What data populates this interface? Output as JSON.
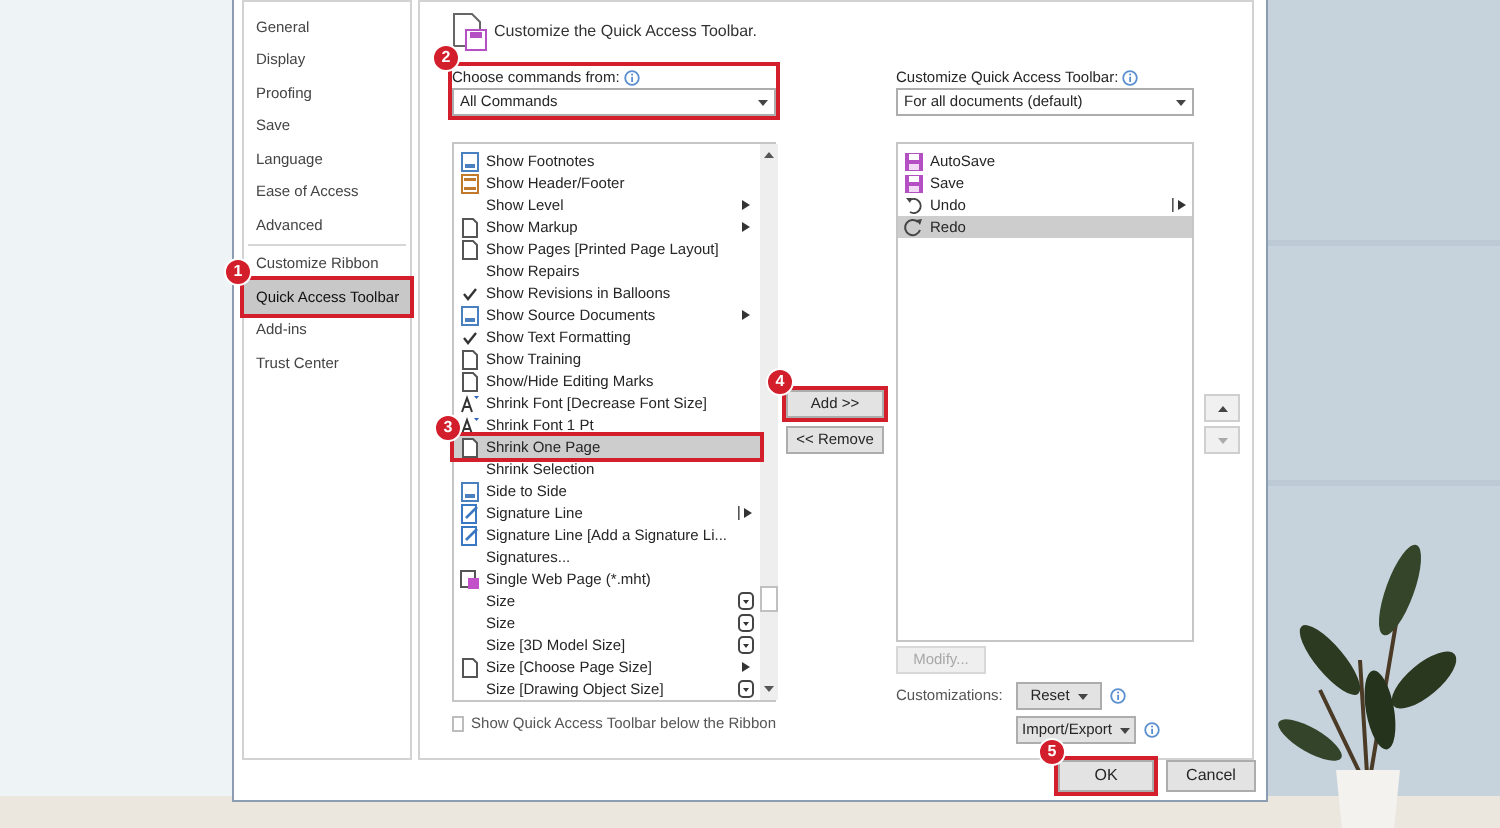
{
  "nav": {
    "groups": [
      {
        "items": [
          {
            "label": "General",
            "selected": false
          },
          {
            "label": "Display",
            "selected": false
          },
          {
            "label": "Proofing",
            "selected": false
          },
          {
            "label": "Save",
            "selected": false
          },
          {
            "label": "Language",
            "selected": false
          },
          {
            "label": "Ease of Access",
            "selected": false
          },
          {
            "label": "Advanced",
            "selected": false
          }
        ]
      },
      {
        "items": [
          {
            "label": "Customize Ribbon",
            "selected": false
          },
          {
            "label": "Quick Access Toolbar",
            "selected": true,
            "step": "1"
          },
          {
            "label": "Add-ins",
            "selected": false
          },
          {
            "label": "Trust Center",
            "selected": false
          }
        ]
      }
    ]
  },
  "main": {
    "title": "Customize the Quick Access Toolbar.",
    "commands_from": {
      "label": "Choose commands from:",
      "value": "All Commands",
      "step": "2"
    },
    "commands": [
      {
        "label": "Show Footnotes",
        "kind": "plain",
        "selected": false
      },
      {
        "label": "Show Header/Footer",
        "kind": "plain",
        "selected": false
      },
      {
        "label": "Show Level",
        "kind": "submenu",
        "selected": false
      },
      {
        "label": "Show Markup",
        "kind": "submenu",
        "selected": false
      },
      {
        "label": "Show Pages [Printed Page Layout]",
        "kind": "plain",
        "selected": false
      },
      {
        "label": "Show Repairs",
        "kind": "plain",
        "selected": false
      },
      {
        "label": "Show Revisions in Balloons",
        "kind": "plain",
        "selected": false
      },
      {
        "label": "Show Source Documents",
        "kind": "submenu",
        "selected": false
      },
      {
        "label": "Show Text Formatting",
        "kind": "plain",
        "selected": false
      },
      {
        "label": "Show Training",
        "kind": "plain",
        "selected": false
      },
      {
        "label": "Show/Hide Editing Marks",
        "kind": "plain",
        "selected": false
      },
      {
        "label": "Shrink Font [Decrease Font Size]",
        "kind": "plain",
        "selected": false
      },
      {
        "label": "Shrink Font 1 Pt",
        "kind": "plain",
        "selected": false
      },
      {
        "label": "Shrink One Page",
        "kind": "plain",
        "selected": true,
        "step": "3"
      },
      {
        "label": "Shrink Selection",
        "kind": "plain",
        "selected": false
      },
      {
        "label": "Side to Side",
        "kind": "plain",
        "selected": false
      },
      {
        "label": "Signature Line",
        "kind": "split",
        "selected": false
      },
      {
        "label": "Signature Line [Add a Signature Li...",
        "kind": "plain",
        "selected": false
      },
      {
        "label": "Signatures...",
        "kind": "plain",
        "selected": false
      },
      {
        "label": "Single Web Page (*.mht)",
        "kind": "plain",
        "selected": false
      },
      {
        "label": "Size",
        "kind": "field",
        "selected": false
      },
      {
        "label": "Size",
        "kind": "field",
        "selected": false
      },
      {
        "label": "Size [3D Model Size]",
        "kind": "field",
        "selected": false
      },
      {
        "label": "Size [Choose Page Size]",
        "kind": "submenu",
        "selected": false
      },
      {
        "label": "Size [Drawing Object Size]",
        "kind": "field",
        "selected": false
      }
    ],
    "show_below_ribbon": {
      "label": "Show Quick Access Toolbar below the Ribbon",
      "checked": false
    },
    "add_button": {
      "label": "Add >>",
      "step": "4"
    },
    "remove_button": {
      "label": "<< Remove"
    },
    "toolbar_for": {
      "label": "Customize Quick Access Toolbar:",
      "value": "For all documents (default)"
    },
    "toolbar_items": [
      {
        "label": "AutoSave",
        "kind": "plain",
        "selected": false
      },
      {
        "label": "Save",
        "kind": "plain",
        "selected": false
      },
      {
        "label": "Undo",
        "kind": "split",
        "selected": false
      },
      {
        "label": "Redo",
        "kind": "plain",
        "selected": true
      }
    ],
    "modify_button": {
      "label": "Modify...",
      "disabled": true
    },
    "customizations_label": "Customizations:",
    "reset_button": {
      "label": "Reset"
    },
    "import_export_button": {
      "label": "Import/Export"
    }
  },
  "footer": {
    "ok": {
      "label": "OK",
      "step": "5"
    },
    "cancel": {
      "label": "Cancel"
    }
  }
}
